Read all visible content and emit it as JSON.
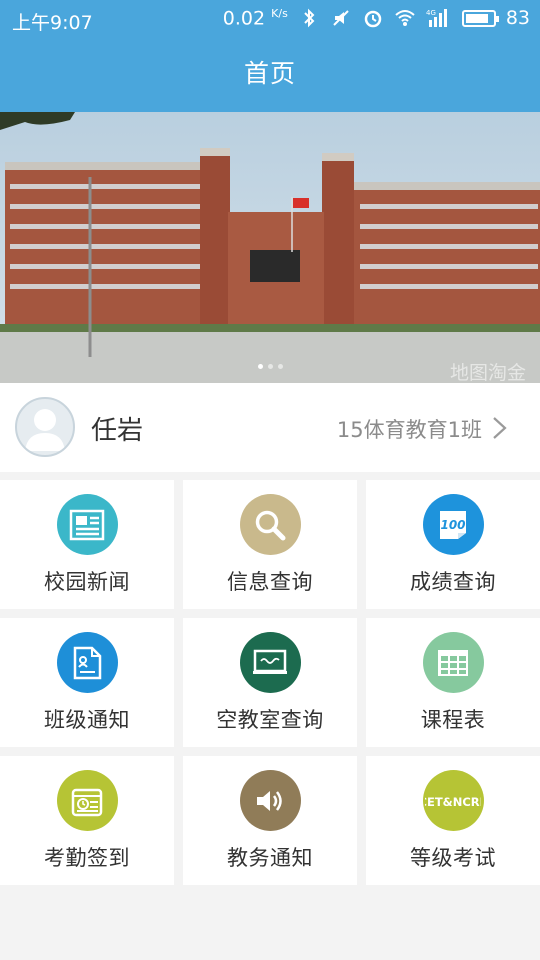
{
  "status_bar": {
    "time": "上午9:07",
    "net_speed": "0.02",
    "net_unit": "K/s",
    "network_type": "4G",
    "battery_percent": "83",
    "battery_level": 0.83
  },
  "nav": {
    "title": "首页"
  },
  "banner": {
    "watermark": "地图淘金"
  },
  "profile": {
    "name": "任岩",
    "class_name": "15体育教育1班"
  },
  "grid": {
    "items": [
      {
        "label": "校园新闻",
        "icon": "news-icon",
        "color": "#3bb7c9"
      },
      {
        "label": "信息查询",
        "icon": "search-icon",
        "color": "#c9b98c"
      },
      {
        "label": "成绩查询",
        "icon": "score-icon",
        "color": "#1e93dc"
      },
      {
        "label": "班级通知",
        "icon": "notice-document-icon",
        "color": "#1e8fd8"
      },
      {
        "label": "空教室查询",
        "icon": "blackboard-icon",
        "color": "#1c6b4f"
      },
      {
        "label": "课程表",
        "icon": "timetable-icon",
        "color": "#86c99e"
      },
      {
        "label": "考勤签到",
        "icon": "checkin-icon",
        "color": "#b6c435"
      },
      {
        "label": "教务通知",
        "icon": "speaker-icon",
        "color": "#907c58"
      },
      {
        "label": "等级考试",
        "icon": "cet-ncre-icon",
        "color": "#b6c435",
        "badge_text": "CET&NCRE"
      }
    ]
  },
  "colors": {
    "primary": "#4aa6dc",
    "background": "#f3f3f3"
  }
}
